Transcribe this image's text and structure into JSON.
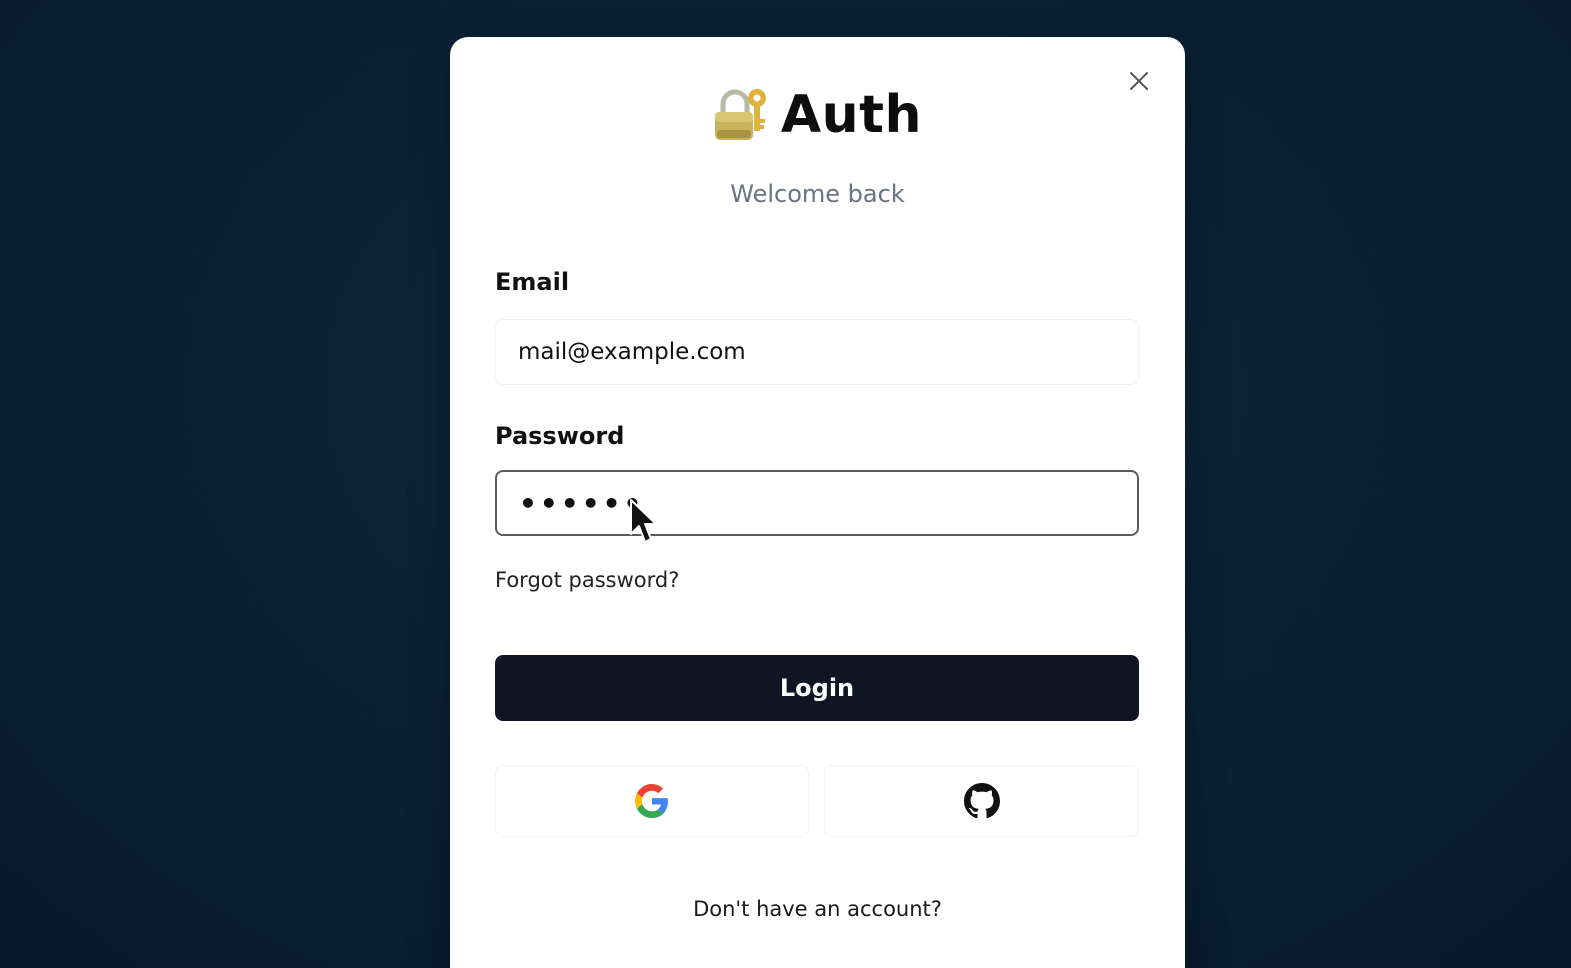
{
  "modal": {
    "title": "Auth",
    "title_icon": "lock-with-key-icon",
    "subtitle": "Welcome back",
    "close_icon": "close-icon"
  },
  "form": {
    "email_label": "Email",
    "email_value": "mail@example.com",
    "password_label": "Password",
    "password_value": "••••••",
    "forgot_link": "Forgot password?",
    "login_button": "Login"
  },
  "social": {
    "google_icon": "google-icon",
    "github_icon": "github-icon"
  },
  "footer": {
    "signup_prompt": "Don't have an account?"
  },
  "colors": {
    "background": "#0b2236",
    "primary_button": "#0f1523",
    "subtitle_text": "#6b7280"
  }
}
